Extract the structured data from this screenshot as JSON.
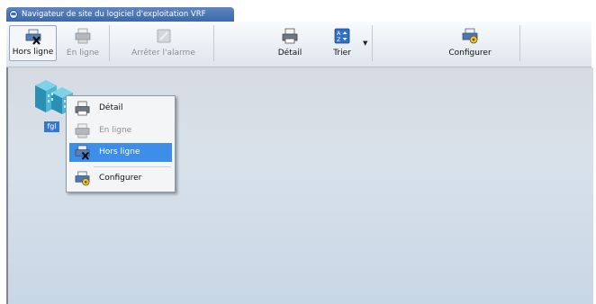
{
  "window": {
    "title": "Navigateur de site du logiciel d'exploitation VRF"
  },
  "toolbar": {
    "buttons": [
      {
        "label": "Hors ligne",
        "icon": "printer-offline-icon",
        "state": "pressed"
      },
      {
        "label": "En ligne",
        "icon": "printer-online-icon",
        "state": "disabled"
      },
      {
        "label": "Arrêter l'alarme",
        "icon": "stop-alarm-icon",
        "state": "disabled"
      },
      {
        "label": "Détail",
        "icon": "detail-icon",
        "state": "enabled"
      },
      {
        "label": "Trier",
        "icon": "sort-az-icon",
        "state": "enabled"
      },
      {
        "label": "Configurer",
        "icon": "configure-icon",
        "state": "enabled"
      }
    ]
  },
  "site": {
    "label": "fgl",
    "icon": "site-buildings-icon"
  },
  "context_menu": {
    "items": [
      {
        "label": "Détail",
        "icon": "detail-icon",
        "state": "enabled"
      },
      {
        "label": "En ligne",
        "icon": "printer-online-icon",
        "state": "disabled"
      },
      {
        "label": "Hors ligne",
        "icon": "printer-offline-icon",
        "state": "highlighted"
      },
      {
        "label": "Configurer",
        "icon": "configure-icon",
        "state": "enabled"
      }
    ]
  },
  "colors": {
    "accent": "#3d8ee8",
    "titlebar": "#4a74b3",
    "selection_label": "#3378d0"
  }
}
